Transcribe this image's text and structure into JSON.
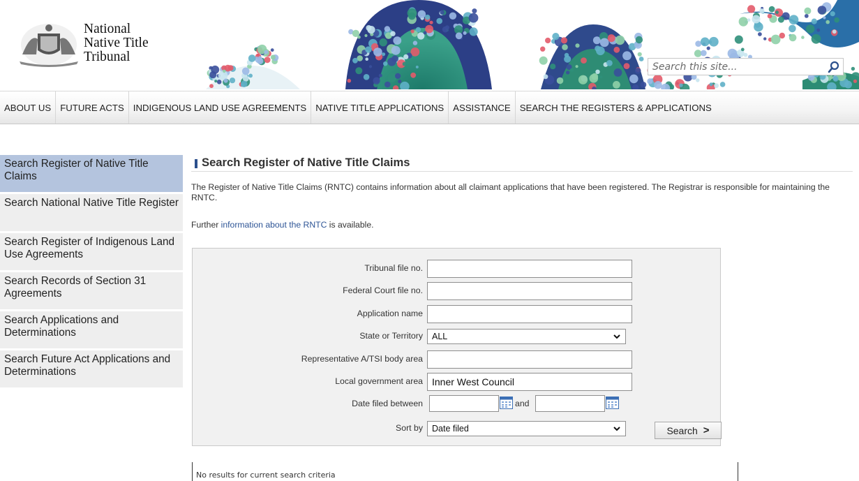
{
  "header": {
    "org_name_lines": [
      "National",
      "Native Title",
      "Tribunal"
    ],
    "search_placeholder": "Search this site...",
    "search_button_icon": "search-icon"
  },
  "nav": {
    "items": [
      "ABOUT US",
      "FUTURE ACTS",
      "INDIGENOUS LAND USE AGREEMENTS",
      "NATIVE TITLE APPLICATIONS",
      "ASSISTANCE",
      "SEARCH THE REGISTERS & APPLICATIONS"
    ]
  },
  "sidebar": {
    "active_index": 0,
    "items": [
      "Search Register of Native Title Claims",
      "Search National Native Title Register",
      "Search Register of Indigenous Land Use Agreements",
      "Search Records of Section 31 Agreements",
      "Search Applications and Determinations",
      "Search Future Act Applications and Determinations"
    ]
  },
  "main": {
    "title": "Search Register of Native Title Claims",
    "intro": "The Register of Native Title Claims (RNTC) contains information about all claimant applications that have been registered. The Registrar is responsible for maintaining the RNTC.",
    "further_prefix": "Further ",
    "further_link": "information about the RNTC",
    "further_suffix": " is available.",
    "form": {
      "tribunal_file_label": "Tribunal file no.",
      "tribunal_file_value": "",
      "federal_court_label": "Federal Court file no.",
      "federal_court_value": "",
      "application_name_label": "Application name",
      "application_name_value": "",
      "state_label": "State or Territory",
      "state_value": "ALL",
      "rep_body_label": "Representative A/TSI body area",
      "rep_body_value": "",
      "lga_label": "Local government area",
      "lga_value": "Inner West Council",
      "date_label": "Date filed between",
      "date_from": "",
      "date_and": "and",
      "date_to": "",
      "sort_label": "Sort by",
      "sort_value": "Date filed",
      "search_label": "Search",
      "search_arrow": ">"
    },
    "results_text": "No results for current search criteria"
  },
  "colors": {
    "nav_bg": "#f4f4f4",
    "sidebar_bg": "#eeeeee",
    "sidebar_active": "#b4c4de",
    "heading_bar": "#2b4f8c",
    "link": "#2e5596",
    "form_bg": "#f1f1f1"
  }
}
